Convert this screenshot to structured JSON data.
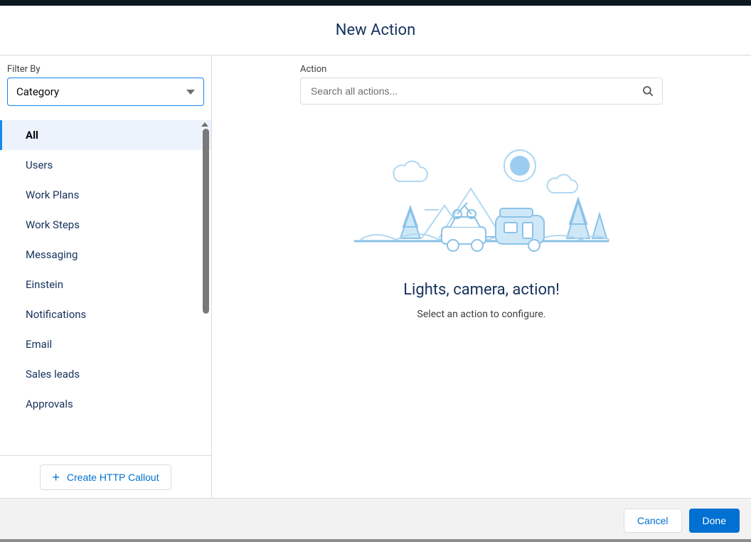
{
  "header": {
    "title": "New Action"
  },
  "sidebar": {
    "filter_label": "Filter By",
    "filter_value": "Category",
    "categories": [
      {
        "label": "All",
        "selected": true
      },
      {
        "label": "Users",
        "selected": false
      },
      {
        "label": "Work Plans",
        "selected": false
      },
      {
        "label": "Work Steps",
        "selected": false
      },
      {
        "label": "Messaging",
        "selected": false
      },
      {
        "label": "Einstein",
        "selected": false
      },
      {
        "label": "Notifications",
        "selected": false
      },
      {
        "label": "Email",
        "selected": false
      },
      {
        "label": "Sales leads",
        "selected": false
      },
      {
        "label": "Approvals",
        "selected": false
      }
    ],
    "http_callout_label": "Create HTTP Callout"
  },
  "main": {
    "action_label": "Action",
    "search_placeholder": "Search all actions...",
    "empty_title": "Lights, camera, action!",
    "empty_subtitle": "Select an action to configure."
  },
  "footer": {
    "cancel_label": "Cancel",
    "done_label": "Done"
  },
  "colors": {
    "accent": "#0070d2",
    "focus_border": "#1589ee",
    "illustration_stroke": "#B1D8F2",
    "illustration_fill": "#CFE8F8"
  }
}
